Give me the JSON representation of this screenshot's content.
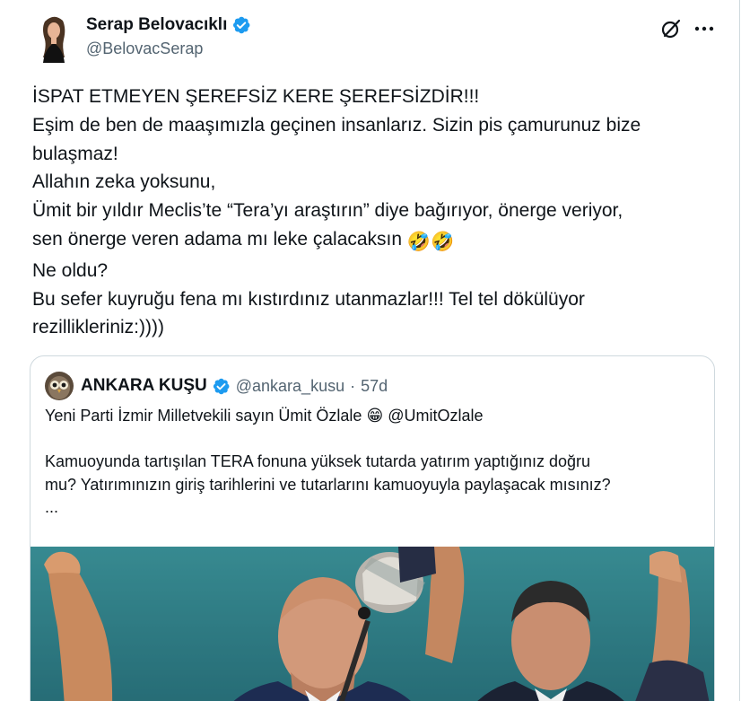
{
  "author": {
    "display_name": "Serap Belovacıklı",
    "handle": "@BelovacSerap"
  },
  "icons": {
    "verified": "verified-badge-icon",
    "grok": "grok-icon",
    "more": "more-icon"
  },
  "colors": {
    "verified_blue": "#1d9bf0",
    "text_primary": "#0f1419",
    "text_secondary": "#536471",
    "border": "#cfd9de"
  },
  "tweet": {
    "lines": [
      "İSPAT ETMEYEN ŞEREFSİZ KERE ŞEREFSİZDİR!!!",
      "Eşim de ben de maaşımızla geçinen insanlarız. Sizin pis çamurunuz bize",
      "bulaşmaz!",
      "Allahın zeka yoksunu,",
      "Ümit bir yıldır Meclis’te “Tera’yı araştırın” diye bağırıyor, önerge veriyor,",
      "sen önerge veren adama mı leke çalacaksın",
      "Ne oldu?",
      "Bu sefer kuyruğu fena mı kıstırdınız utanmazlar!!! Tel tel dökülüyor",
      "rezillikleriniz:))))"
    ],
    "emoji": "🤣🤣"
  },
  "quote": {
    "display_name": "ANKARA KUŞU",
    "handle": "@ankara_kusu",
    "separator": "·",
    "time": "57d",
    "line1_text": "Yeni Parti İzmir Milletvekili sayın Ümit Özlale",
    "line1_emoji": "😁",
    "line1_mention": "@UmitOzlale",
    "lines": [
      "Kamuoyunda tartışılan TERA fonuna yüksek tutarda yatırım yaptığınız doğru",
      "mu? Yatırımınızın giriş tarihlerini ve tutarlarını kamuoyuyla paylaşacak mısınız?",
      "..."
    ]
  }
}
